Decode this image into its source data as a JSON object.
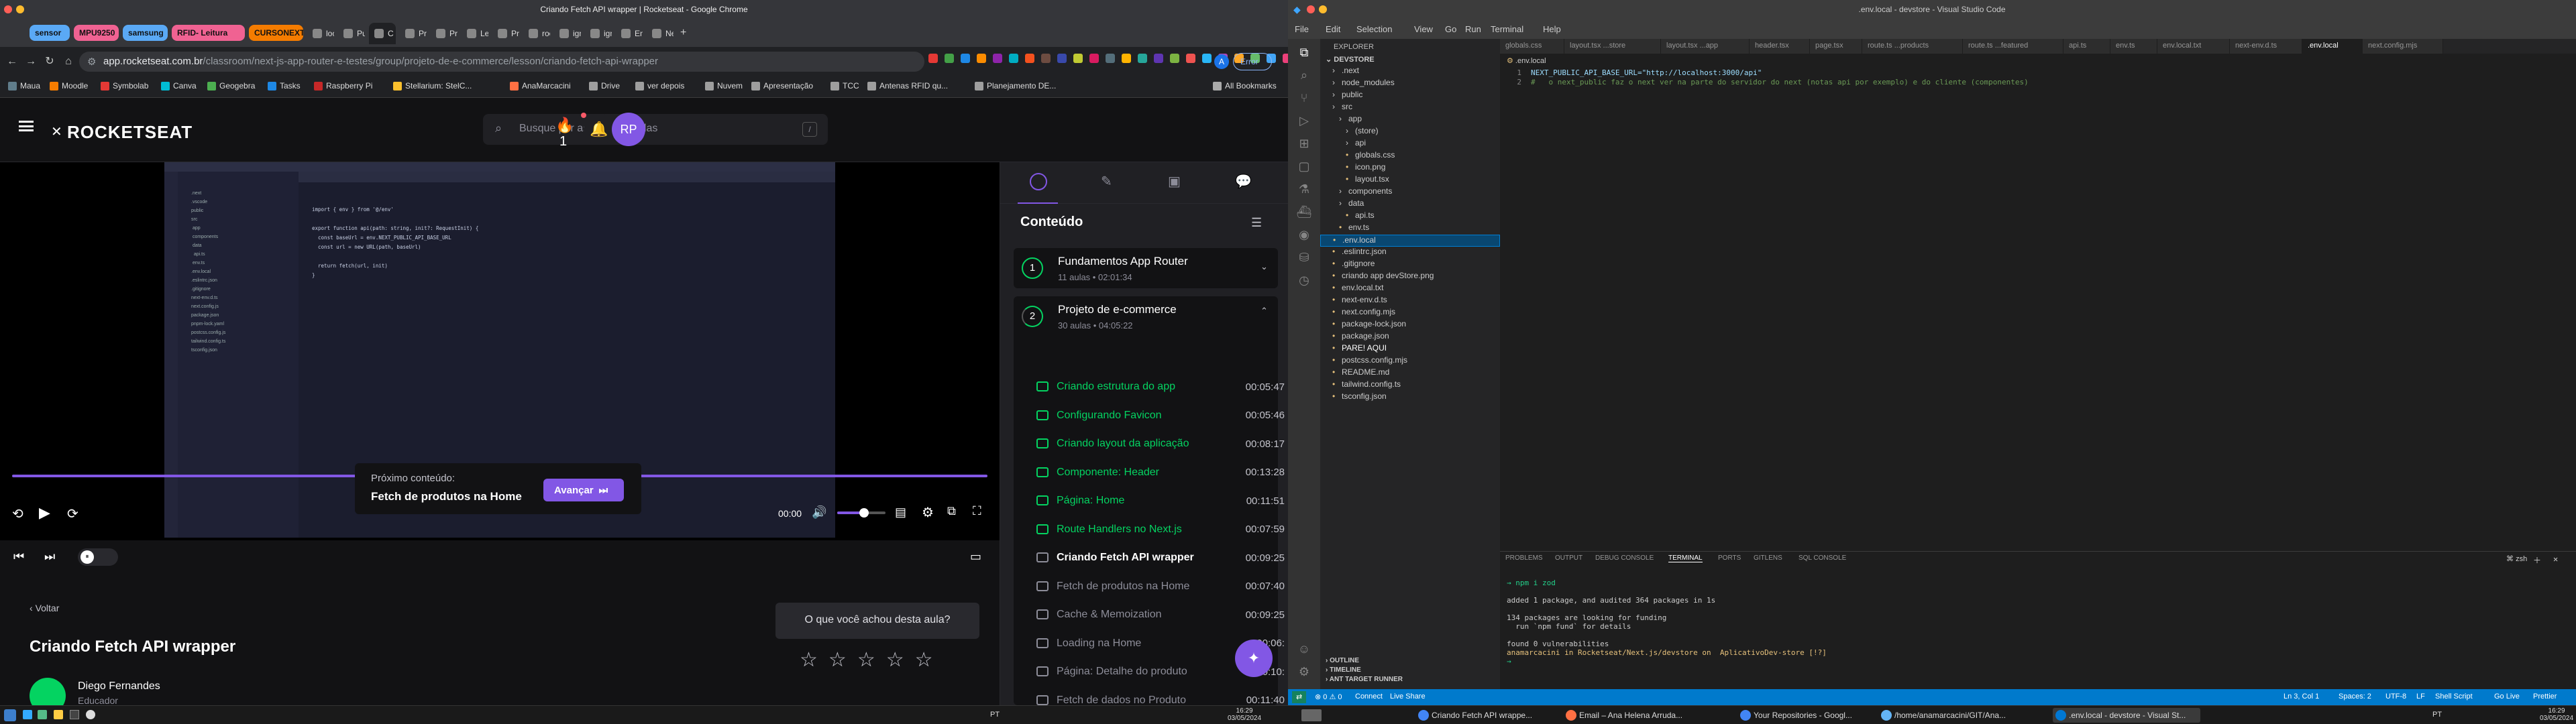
{
  "chrome": {
    "window_title": "Criando Fetch API wrapper | Rocketseat - Google Chrome",
    "tabs": [
      {
        "label": "sensor",
        "group": true,
        "color": "#5aa9f5"
      },
      {
        "label": "MPU9250",
        "group": true,
        "color": "#f06292"
      },
      {
        "label": "samsung",
        "group": true,
        "color": "#5aa9f5"
      },
      {
        "label": "RFID- Leitura",
        "group": true,
        "color": "#f06292"
      },
      {
        "label": "CURSONEXT",
        "group": true,
        "color": "#f57c00"
      },
      {
        "label": "local",
        "group": false
      },
      {
        "label": "Punc",
        "group": false
      },
      {
        "label": "C",
        "group": false,
        "active": true
      },
      {
        "label": "Proj",
        "group": false
      },
      {
        "label": "Prog",
        "group": false
      },
      {
        "label": "Lear",
        "group": false
      },
      {
        "label": "Prog",
        "group": false
      },
      {
        "label": "rock",
        "group": false
      },
      {
        "label": "igni",
        "group": false
      },
      {
        "label": "igni",
        "group": false
      },
      {
        "label": "Enco",
        "group": false
      },
      {
        "label": "New",
        "group": false
      }
    ],
    "url_host": "app.rocketseat.com.br",
    "url_path": "/classroom/next-js-app-router-e-testes/group/projeto-de-e-commerce/lesson/criando-fetch-api-wrapper",
    "error_badge": "Error",
    "bookmarks": [
      "Maua",
      "Moodle",
      "Symbolab",
      "Canva",
      "Geogebra",
      "Tasks",
      "Raspberry Pi",
      "Stellarium: StelC...",
      "AnaMarcacini",
      "Drive",
      "ver depois",
      "Nuvem",
      "Apresentação",
      "TCC",
      "Antenas RFID qu...",
      "Planejamento DE..."
    ],
    "all_bookmarks": "All Bookmarks"
  },
  "rocketseat": {
    "logo": "ROCKETSEAT",
    "search_placeholder": "Busque por assuntos e aulas",
    "search_key": "/",
    "streak": "1",
    "avatar": "RP",
    "next_label": "Próximo conteúdo:",
    "next_title": "Fetch de produtos na Home",
    "advance_button": "Avançar",
    "video_time": "00:00",
    "video_progress": 0,
    "volume_level": 0.55,
    "back_link": "Voltar",
    "lesson_title": "Criando Fetch API wrapper",
    "rate_question": "O que você achou desta aula?",
    "stars": 5,
    "instructor_name": "Diego Fernandes",
    "instructor_role": "Educador",
    "sidebar_title": "Conteúdo",
    "modules": [
      {
        "number": "1",
        "title": "Fundamentos App Router",
        "meta": "11 aulas • 02:01:34"
      },
      {
        "number": "2",
        "title": "Projeto de e-commerce",
        "meta": "30 aulas • 04:05:22"
      }
    ],
    "lessons": [
      {
        "title": "Criando estrutura do app",
        "duration": "00:05:47",
        "status": "done"
      },
      {
        "title": "Configurando Favicon",
        "duration": "00:05:46",
        "status": "done"
      },
      {
        "title": "Criando layout da aplicação",
        "duration": "00:08:17",
        "status": "done"
      },
      {
        "title": "Componente: Header",
        "duration": "00:13:28",
        "status": "done"
      },
      {
        "title": "Página: Home",
        "duration": "00:11:51",
        "status": "done"
      },
      {
        "title": "Route Handlers no Next.js",
        "duration": "00:07:59",
        "status": "done"
      },
      {
        "title": "Criando Fetch API wrapper",
        "duration": "00:09:25",
        "status": "current"
      },
      {
        "title": "Fetch de produtos na Home",
        "duration": "00:07:40",
        "status": "todo"
      },
      {
        "title": "Cache & Memoization",
        "duration": "00:09:25",
        "status": "todo"
      },
      {
        "title": "Loading na Home",
        "duration": "00:06:",
        "status": "todo"
      },
      {
        "title": "Página: Detalhe do produto",
        "duration": "00:10:",
        "status": "todo"
      },
      {
        "title": "Fetch de dados no Produto",
        "duration": "00:11:40",
        "status": "todo"
      }
    ]
  },
  "embedded_video": {
    "code_lines": [
      "import { env } from '@/env'",
      "",
      "export function api(path: string, init?: RequestInit) {",
      "  const baseUrl = env.NEXT_PUBLIC_API_BASE_URL",
      "  const url = new URL(path, baseUrl)",
      "",
      "  return fetch(url, init)",
      "}"
    ]
  },
  "vscode": {
    "window_title": ".env.local - devstore - Visual Studio Code",
    "menu": [
      "File",
      "Edit",
      "Selection",
      "View",
      "Go",
      "Run",
      "Terminal",
      "Help"
    ],
    "explorer_title": "EXPLORER",
    "workspace": "DEVSTORE",
    "tree": [
      {
        "name": ".next",
        "depth": 1,
        "kind": "folder"
      },
      {
        "name": "node_modules",
        "depth": 1,
        "kind": "folder"
      },
      {
        "name": "public",
        "depth": 1,
        "kind": "folder"
      },
      {
        "name": "src",
        "depth": 1,
        "kind": "folder"
      },
      {
        "name": "app",
        "depth": 2,
        "kind": "folder"
      },
      {
        "name": "(store)",
        "depth": 3,
        "kind": "folder"
      },
      {
        "name": "api",
        "depth": 3,
        "kind": "folder"
      },
      {
        "name": "globals.css",
        "depth": 3,
        "kind": "file"
      },
      {
        "name": "icon.png",
        "depth": 3,
        "kind": "file"
      },
      {
        "name": "layout.tsx",
        "depth": 3,
        "kind": "file"
      },
      {
        "name": "components",
        "depth": 2,
        "kind": "folder"
      },
      {
        "name": "data",
        "depth": 2,
        "kind": "folder"
      },
      {
        "name": "api.ts",
        "depth": 3,
        "kind": "file"
      },
      {
        "name": "env.ts",
        "depth": 2,
        "kind": "file"
      },
      {
        "name": ".env.local",
        "depth": 1,
        "kind": "file",
        "selected": true
      },
      {
        "name": ".eslintrc.json",
        "depth": 1,
        "kind": "file"
      },
      {
        "name": ".gitignore",
        "depth": 1,
        "kind": "file"
      },
      {
        "name": "criando app devStore.png",
        "depth": 1,
        "kind": "file"
      },
      {
        "name": "env.local.txt",
        "depth": 1,
        "kind": "file"
      },
      {
        "name": "next-env.d.ts",
        "depth": 1,
        "kind": "file"
      },
      {
        "name": "next.config.mjs",
        "depth": 1,
        "kind": "file"
      },
      {
        "name": "package-lock.json",
        "depth": 1,
        "kind": "file"
      },
      {
        "name": "package.json",
        "depth": 1,
        "kind": "file"
      },
      {
        "name": "PARE! AQUI",
        "depth": 1,
        "kind": "file"
      },
      {
        "name": "postcss.config.mjs",
        "depth": 1,
        "kind": "file"
      },
      {
        "name": "README.md",
        "depth": 1,
        "kind": "file"
      },
      {
        "name": "tailwind.config.ts",
        "depth": 1,
        "kind": "file"
      },
      {
        "name": "tsconfig.json",
        "depth": 1,
        "kind": "file"
      }
    ],
    "outline_sections": [
      "OUTLINE",
      "TIMELINE",
      "ANT TARGET RUNNER"
    ],
    "tabs": [
      "globals.css",
      "layout.tsx ...store",
      "layout.tsx ...app",
      "header.tsx",
      "page.tsx",
      "route.ts ...products",
      "route.ts ...featured",
      "api.ts",
      "env.ts",
      "env.local.txt",
      "next-env.d.ts",
      ".env.local",
      "next.config.mjs"
    ],
    "breadcrumb": ".env.local",
    "editor_lines": [
      {
        "n": "1",
        "text": "NEXT_PUBLIC_API_BASE_URL=\"http://localhost:3000/api\""
      },
      {
        "n": "2",
        "text": "#   o next_public faz o next ver na parte do servidor do next (notas api por exemplo) e do cliente (componentes)"
      }
    ],
    "panel_tabs": [
      "PROBLEMS",
      "OUTPUT",
      "DEBUG CONSOLE",
      "TERMINAL",
      "PORTS",
      "GITLENS",
      "SQL CONSOLE"
    ],
    "active_panel_tab": "TERMINAL",
    "terminal_shell": "zsh",
    "terminal_lines": [
      "→ npm i zod",
      "",
      "added 1 package, and audited 364 packages in 1s",
      "",
      "134 packages are looking for funding",
      "  run `npm fund` for details",
      "",
      "found 0 vulnerabilities",
      "anamarcacini in Rocketseat/Next.js/devstore on  AplicativoDev-store [!?]",
      "→ "
    ],
    "status_left": [
      "Connect",
      "Live Share"
    ],
    "status_right": [
      "Ln 3, Col 1",
      "Spaces: 2",
      "UTF-8",
      "LF",
      "Shell Script",
      "Go Live",
      "Prettier"
    ]
  },
  "taskbar": {
    "windows": [
      {
        "label": "Criando Fetch API wrappe...",
        "color": "#4285f4"
      },
      {
        "label": "Email – Ana Helena Arruda...",
        "color": "#ff7043"
      },
      {
        "label": "Your Repositories - Googl...",
        "color": "#4285f4"
      },
      {
        "label": "/home/anamarcacini/GIT/Ana...",
        "color": "#64b5f6"
      },
      {
        "label": ".env.local - devstore - Visual St...",
        "color": "#0078d4"
      }
    ],
    "lang": "PT",
    "time_left": "16:29",
    "date_left": "03/05/2024",
    "time_right": "16:29",
    "date_right": "03/05/2024"
  }
}
